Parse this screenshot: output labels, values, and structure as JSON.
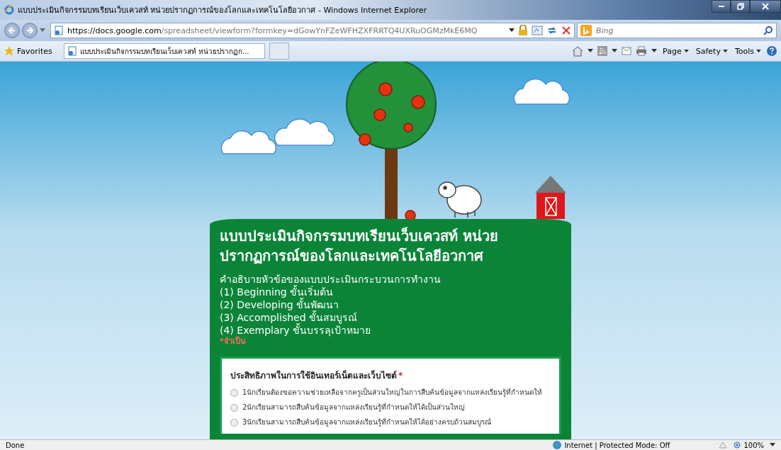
{
  "window": {
    "title": "แบบประเมินกิจกรรมบทเรียนเว็บเควสท์ หน่วยปรากฏการณ์ของโลกและเทคโนโลยีอวกาศ - Windows Internet Explorer"
  },
  "address": {
    "url_prefix": "https://docs.",
    "url_domain": "google.com",
    "url_rest": "/spreadsheet/viewform?formkey=dGowYnFZeWFHZXFRRTQ4UXRuOGMzMkE6MQ"
  },
  "search": {
    "placeholder": "Bing"
  },
  "favorites": {
    "label": "Favorites"
  },
  "tabs": [
    {
      "label": "แบบประเมินกิจกรรมบทเรียนเว็บเควสท์ หน่วยปรากฏก...",
      "selected": true
    }
  ],
  "commands": [
    "Page",
    "Safety",
    "Tools"
  ],
  "form": {
    "title": "แบบประเมินกิจกรรมบทเรียนเว็บเควสท์ หน่วยปรากฏการณ์ของโลกและเทคโนโลยีอวกาศ",
    "description": [
      "คำอธิบายหัวข้อของแบบประเมินกระบวนการทำงาน",
      "(1)  Beginning  ขั้นเริ่มต้น",
      "(2)  Developing  ขั้นพัฒนา",
      "(3)  Accomplished  ขั้นสมบูรณ์",
      "(4)  Exemplary  ขั้นบรรลุเป้าหมาย"
    ],
    "required_note": "*จำเป็น",
    "question": {
      "title": "ประสิทธิภาพในการใช้อินเทอร์เน็ตและเว็บไซต์",
      "required_mark": "*",
      "options": [
        {
          "label": "1นักเรียนต้องขอความช่วยเหลือจากครูเป็นส่วนใหญ่ในการสืบค้นข้อมูลจากแหล่งเรียนรู้ที่กำหนดให้",
          "selected": false
        },
        {
          "label": "2นักเรียนสามารถสืบค้นข้อมูลจากแหล่งเรียนรู้ที่กำหนดให้ได้เป็นส่วนใหญ่",
          "selected": false
        },
        {
          "label": "3นักเรียนสามารถสืบค้นข้อมูลจากแหล่งเรียนรู้ที่กำหนดให้ได้อย่างครบถ้วนสมบูรณ์",
          "selected": false
        }
      ]
    }
  },
  "status_bar": {
    "text": "Done",
    "zone": "Internet | Protected Mode: Off",
    "zoom": "100%"
  }
}
